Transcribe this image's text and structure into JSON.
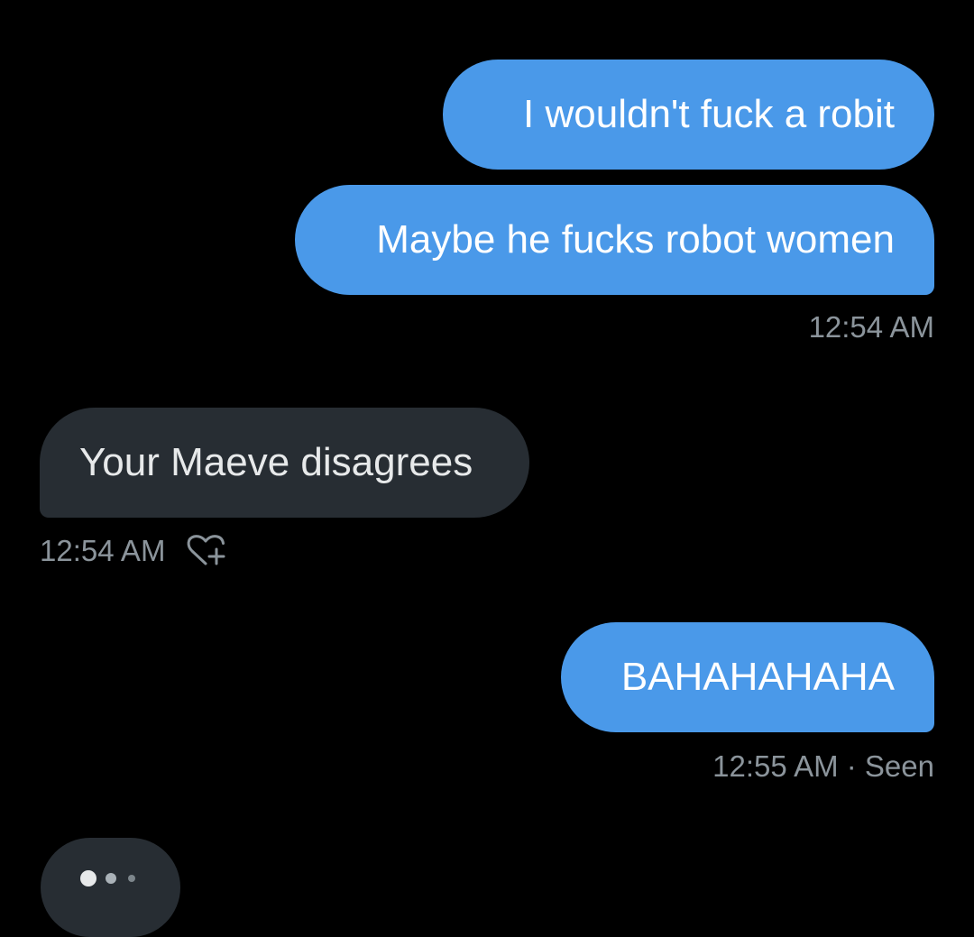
{
  "messages": [
    {
      "direction": "outgoing",
      "text": "I wouldn't fuck a robit"
    },
    {
      "direction": "outgoing",
      "text": "Maybe he fucks robot women"
    },
    {
      "direction": "incoming",
      "text": "Your Maeve disagrees"
    },
    {
      "direction": "outgoing",
      "text": "BAHAHAHAHA"
    }
  ],
  "timestamps": {
    "group1": "12:54 AM",
    "group2": "12:54 AM",
    "group3": "12:55 AM · Seen"
  },
  "icons": {
    "reaction": "add-reaction-heart-icon",
    "typing": "typing-indicator-dots"
  },
  "colors": {
    "background": "#000000",
    "outgoing_bubble": "#4a99e9",
    "incoming_bubble": "#272d33",
    "meta_text": "#8b949b"
  }
}
